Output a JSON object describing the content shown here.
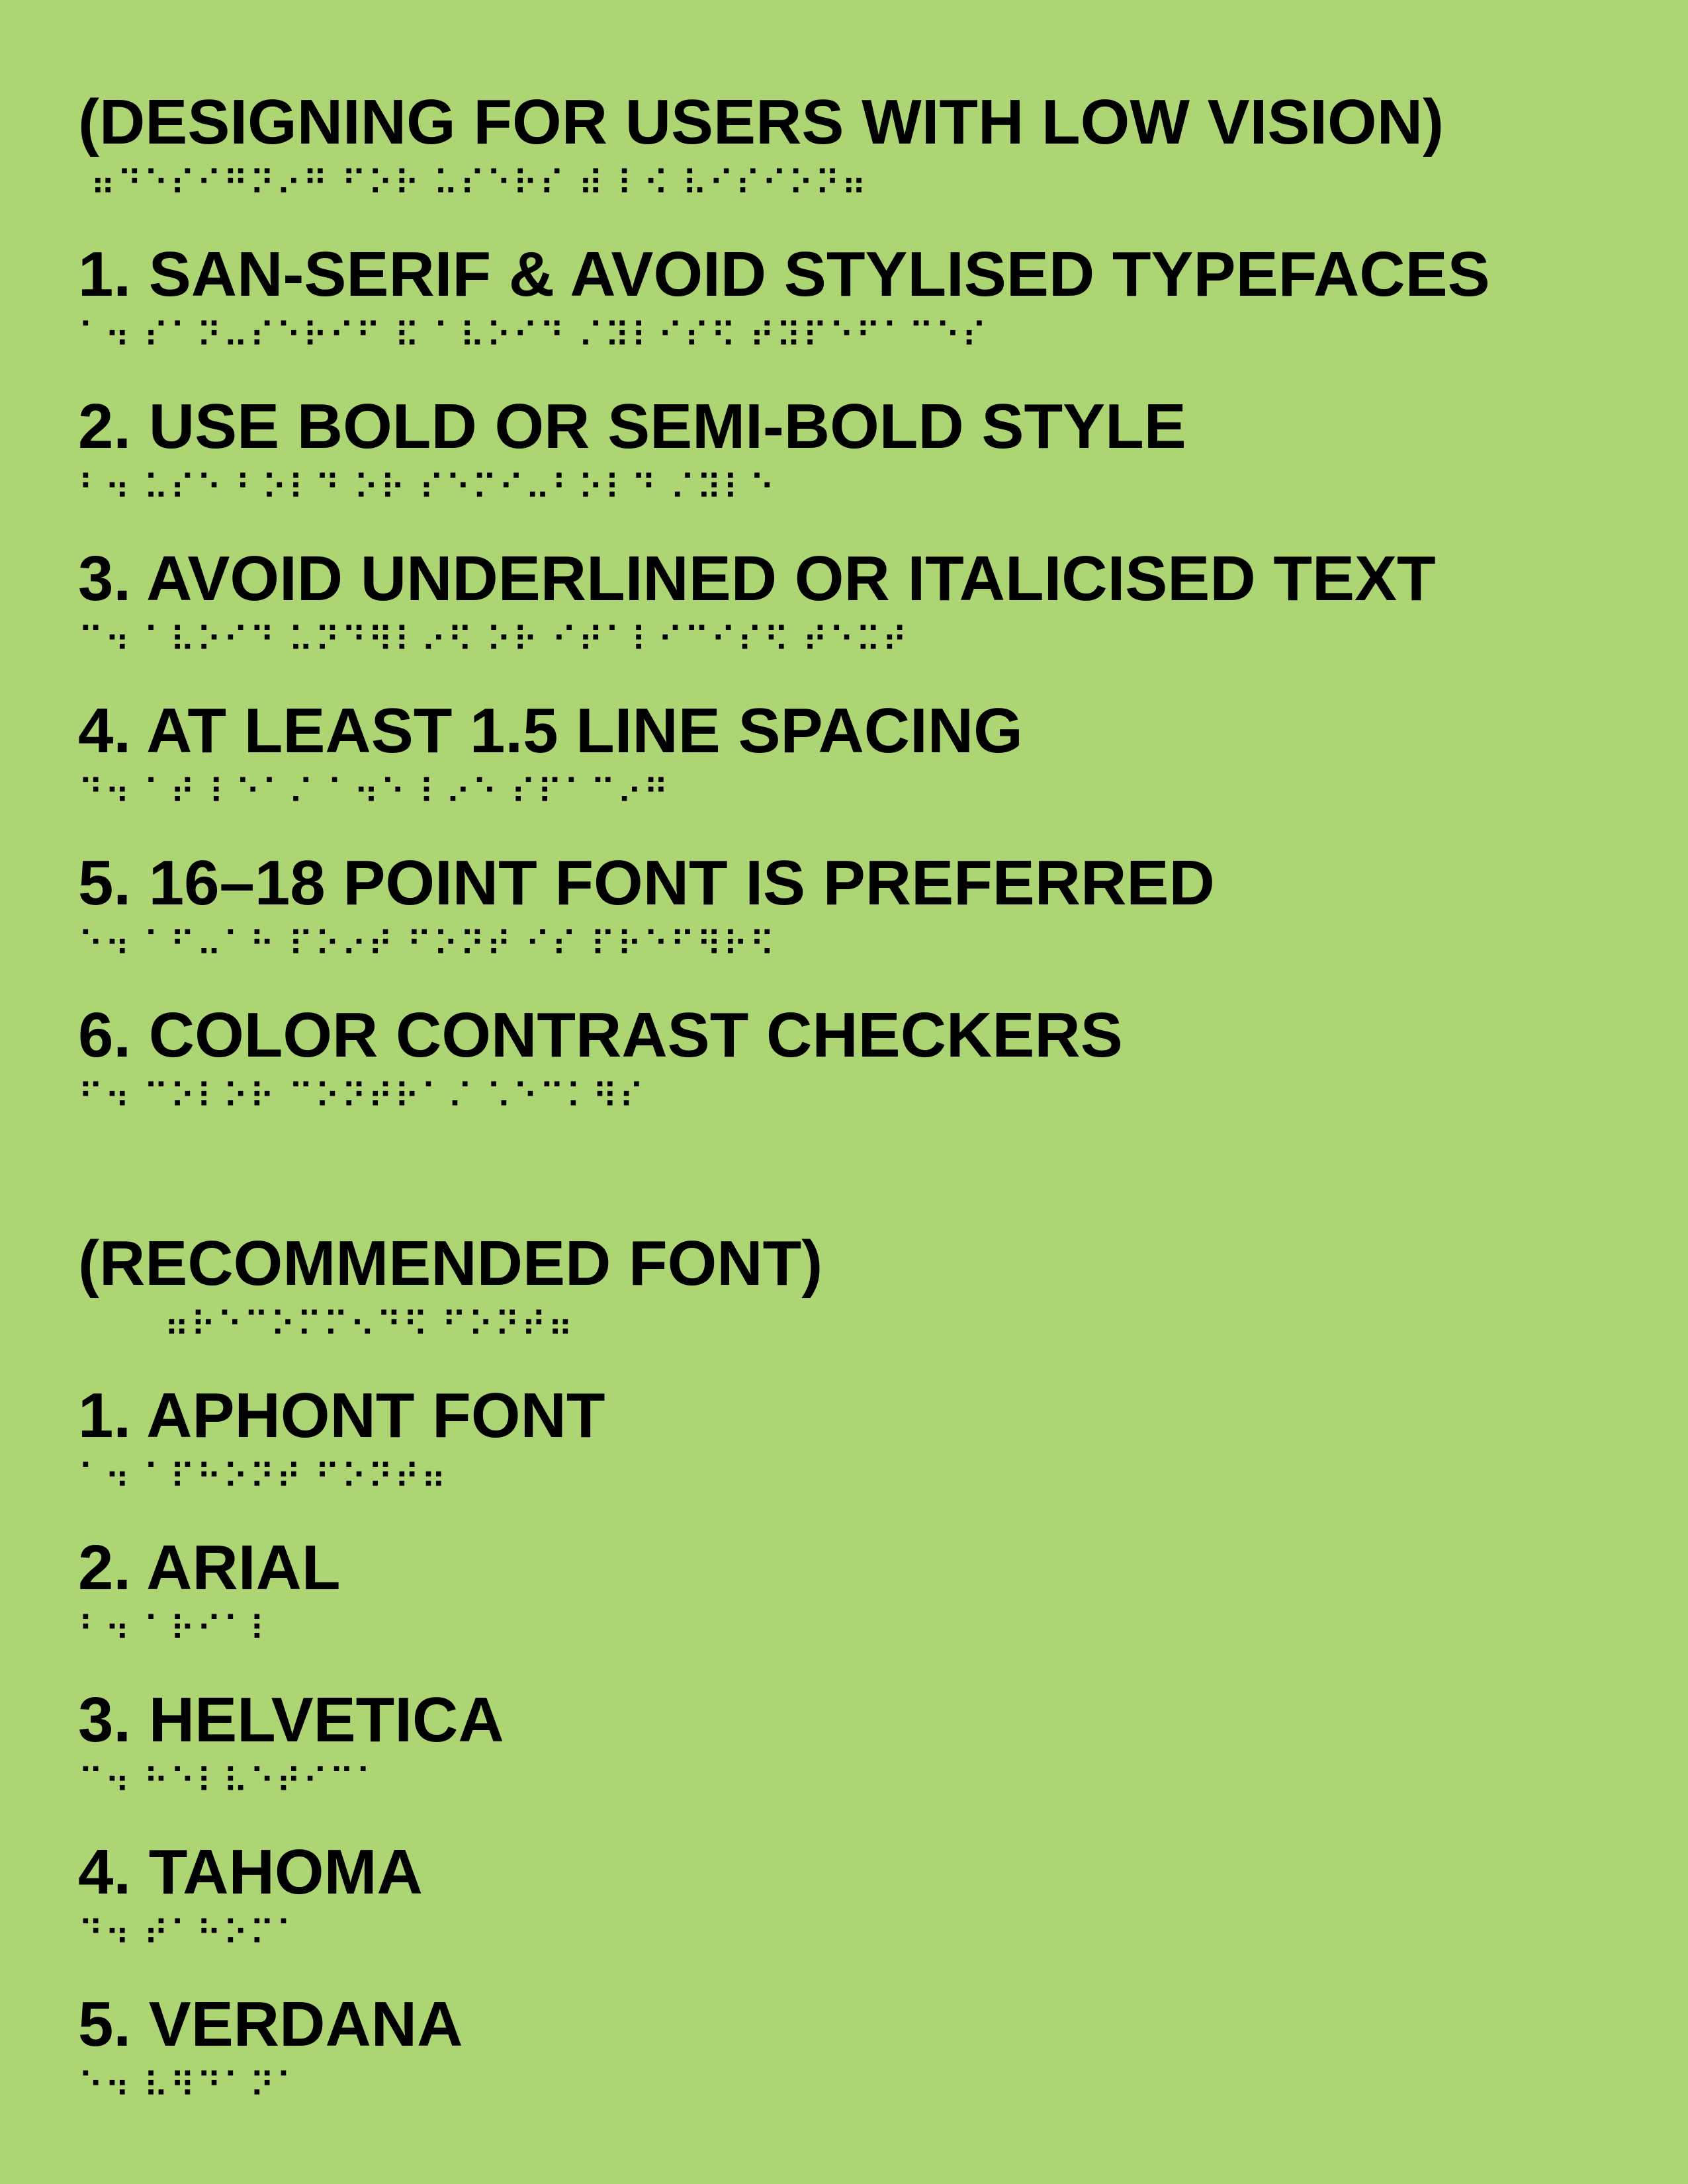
{
  "background_color": "#add573",
  "text_color": "#000000",
  "section1": {
    "heading": {
      "text": "(DESIGNING FOR USERS WITH LOW VISION)",
      "braille": " ⠶⠙⠑⠎⠊⠛⠝⠔⠛ ⠋⠕⠗ ⠥⠎⠑⠗⠎ ⠾ ⠇⠪ ⠧⠊⠎⠊⠕⠝⠶"
    },
    "items": [
      {
        "text": "1. SAN-SERIF & AVOID STYLISED TYPEFACES",
        "braille": "⠁⠲ ⠎⠁⠝⠤⠎⠑⠗⠊⠋ ⠯ ⠁⠧⠕⠊⠙ ⠌⠽⠇⠊⠎⠫ ⠞⠽⠏⠑⠋⠁⠉⠑⠎"
      },
      {
        "text": "2. USE BOLD OR SEMI-BOLD STYLE",
        "braille": "⠃⠲ ⠥⠎⠑ ⠃⠕⠇⠙ ⠕⠗ ⠎⠑⠍⠊⠤⠃⠕⠇⠙ ⠌⠽⠇⠑"
      },
      {
        "text": "3. AVOID UNDERLINED OR ITALICISED TEXT",
        "braille": "⠉⠲ ⠁⠧⠕⠊⠙ ⠥⠝⠙⠻⠇⠔⠫ ⠕⠗ ⠊⠞⠁⠇⠊⠉⠊⠎⠫ ⠞⠑⠭⠞"
      },
      {
        "text": "4. AT LEAST 1.5 LINE SPACING",
        "braille": "⠙⠲ ⠁⠞ ⠇⠑⠁⠌ ⠁⠲⠑ ⠇⠔⠑ ⠎⠏⠁⠉⠔⠛"
      },
      {
        "text": "5. 16–18 POINT FONT IS PREFERRED",
        "braille": "⠑⠲ ⠁⠋⠤⠁⠓ ⠏⠕⠔⠞ ⠋⠕⠝⠞ ⠊⠎ ⠏⠗⠑⠋⠻⠗⠫"
      },
      {
        "text": "6. COLOR CONTRAST CHECKERS",
        "braille": "⠋⠲ ⠉⠕⠇⠕⠗ ⠉⠕⠝⠞⠗⠁⠌ ⠡⠑⠉⠅⠻⠎"
      }
    ]
  },
  "section2": {
    "heading": {
      "text": "(RECOMMENDED FONT)",
      "braille": "⠶⠗⠑⠉⠕⠍⠍⠢⠙⠫ ⠋⠕⠝⠞⠶"
    },
    "items": [
      {
        "text": "1. APHONT FONT",
        "braille": "⠁⠲ ⠁⠏⠓⠕⠝⠞ ⠋⠕⠝⠞⠶"
      },
      {
        "text": "2. ARIAL",
        "braille": "⠃⠲ ⠁⠗⠊⠁⠇"
      },
      {
        "text": "3. HELVETICA",
        "braille": "⠉⠲ ⠓⠑⠇⠧⠑⠞⠊⠉⠁"
      },
      {
        "text": "4. TAHOMA",
        "braille": "⠙⠲ ⠞⠁⠓⠕⠍⠁"
      },
      {
        "text": "5. VERDANA",
        "braille": "⠑⠲ ⠧⠻⠙⠁⠝⠁"
      }
    ]
  }
}
